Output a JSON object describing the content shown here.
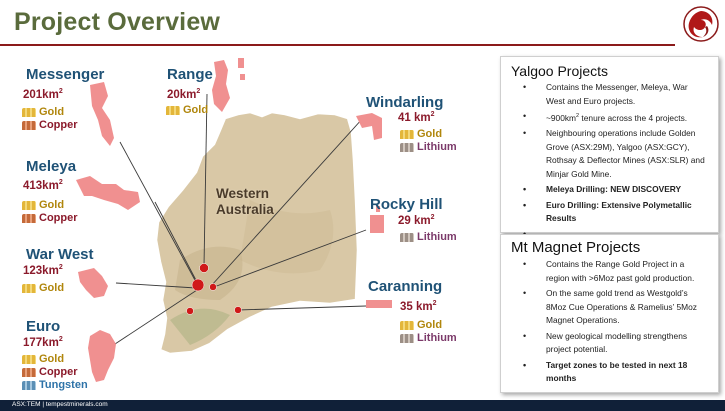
{
  "title": "Project Overview",
  "map": {
    "state_label": [
      "Western",
      "Australia"
    ],
    "regions": [
      {
        "name": "Messenger",
        "area": "201km",
        "area_sup": "2",
        "commodities": [
          "Gold",
          "Copper"
        ]
      },
      {
        "name": "Range",
        "area": "20km",
        "area_sup": "2",
        "commodities": [
          "Gold"
        ]
      },
      {
        "name": "Windarling",
        "area": "41 km",
        "area_sup": "2",
        "commodities": [
          "Gold",
          "Lithium"
        ]
      },
      {
        "name": "Meleya",
        "area": "413km",
        "area_sup": "2",
        "commodities": [
          "Gold",
          "Copper"
        ]
      },
      {
        "name": "Rocky Hill",
        "area": "29 km",
        "area_sup": "2",
        "commodities": [
          "Lithium"
        ]
      },
      {
        "name": "War West",
        "area": "123km",
        "area_sup": "2",
        "commodities": [
          "Gold"
        ]
      },
      {
        "name": "Caranning",
        "area": "35 km",
        "area_sup": "2",
        "commodities": [
          "Gold",
          "Lithium"
        ]
      },
      {
        "name": "Euro",
        "area": "177km",
        "area_sup": "2",
        "commodities": [
          "Gold",
          "Copper",
          "Tungsten"
        ]
      }
    ],
    "colors": {
      "tenement": "#f08a8a",
      "map_land": "#d8c7a6",
      "marker": "#d01919",
      "heading": "#1f5276"
    }
  },
  "yalgoo": {
    "heading": "Yalgoo Projects",
    "items": [
      {
        "text": "Contains the Messenger, Meleya, War West and Euro projects."
      },
      {
        "pre": "~900km",
        "sup": "2",
        "post": " tenure across the 4 projects."
      },
      {
        "text": "Neighbouring operations include Golden Grove (ASX:29M),  Yalgoo (ASX:GCY), Rothsay & Deflector Mines (ASX:SLR) and Minjar Gold Mine."
      },
      {
        "text": "Meleya Drilling: NEW DISCOVERY",
        "bold": true
      },
      {
        "text": "Euro Drilling: Extensive Polymetallic Results",
        "bold": true
      },
      {
        "text": ""
      }
    ]
  },
  "mt_magnet": {
    "heading": "Mt Magnet Projects",
    "items": [
      {
        "text": "Contains the Range Gold Project in a region with >6Moz past gold production."
      },
      {
        "text": "On the same gold trend as Westgold’s 8Moz Cue Operations & Ramelius’ 5Moz Magnet Operations."
      },
      {
        "text": "New geological modelling strengthens project potential."
      },
      {
        "text": "Target zones to be tested  in next 18 months",
        "bold": true
      }
    ]
  },
  "footer": {
    "text": "ASX:TEM | tempestminerals.com"
  }
}
